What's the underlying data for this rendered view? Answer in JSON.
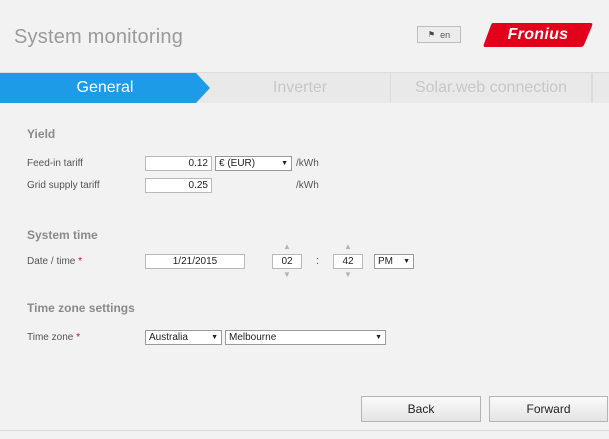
{
  "header": {
    "title": "System monitoring",
    "language": "en",
    "brand": "Fronius",
    "brand_color": "#e2001a"
  },
  "tabs": [
    {
      "label": "General",
      "active": true
    },
    {
      "label": "Inverter",
      "active": false
    },
    {
      "label": "Solar.web connection",
      "active": false
    }
  ],
  "accent_color": "#1e9be6",
  "yield": {
    "title": "Yield",
    "feed_in": {
      "label": "Feed-in tariff",
      "value": "0.12",
      "currency": "€ (EUR)",
      "unit": "/kWh"
    },
    "grid_supply": {
      "label": "Grid supply tariff",
      "value": "0.25",
      "unit": "/kWh"
    }
  },
  "system_time": {
    "title": "System time",
    "label": "Date / time",
    "required_mark": "*",
    "date": "1/21/2015",
    "hour": "02",
    "minute": "42",
    "separator": ":",
    "ampm": "PM"
  },
  "timezone": {
    "title": "Time zone settings",
    "label": "Time zone",
    "required_mark": "*",
    "region": "Australia",
    "city": "Melbourne"
  },
  "buttons": {
    "back": "Back",
    "forward": "Forward"
  }
}
